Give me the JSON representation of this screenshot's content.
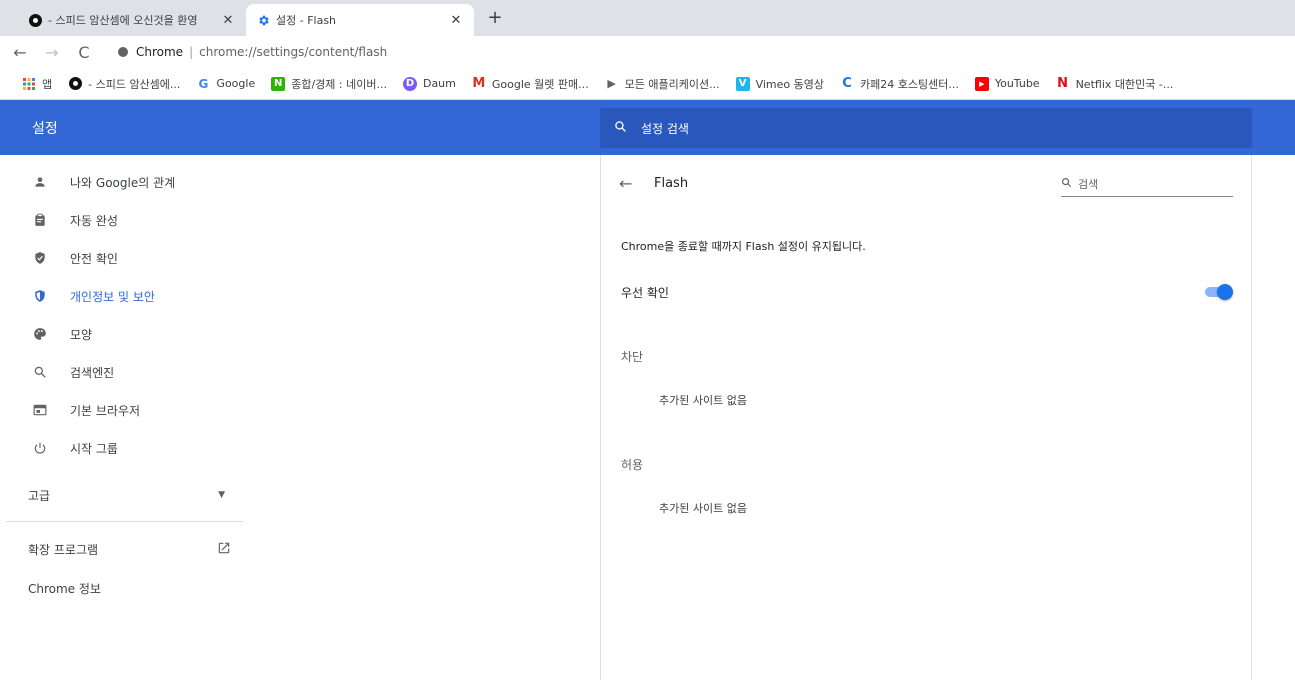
{
  "tabs": [
    {
      "title": "- 스피드 암산셈에 오신것을 환영",
      "close": "✕"
    },
    {
      "title": "설정 - Flash",
      "close": "✕"
    }
  ],
  "newtab": "+",
  "toolbar": {
    "back": "←",
    "forward": "→",
    "reload": "C",
    "site_label": "Chrome",
    "url": "chrome://settings/content/flash"
  },
  "bookmarks": [
    {
      "label": "앱",
      "icon": "apps-grid-icon",
      "color": "#e8453c"
    },
    {
      "label": "- 스피드 암산셈에...",
      "icon": "circle-icon",
      "color": "#111111"
    },
    {
      "label": "Google",
      "icon": "google-icon",
      "color": "#4285f4"
    },
    {
      "label": "종합/경제 : 네이버...",
      "icon": "naver-icon",
      "color": "#2db400"
    },
    {
      "label": "Daum",
      "icon": "daum-icon",
      "color": "#7a5af8"
    },
    {
      "label": "Google 월렛 판매...",
      "icon": "gmail-icon",
      "color": "#d93025"
    },
    {
      "label": "모든 애플리케이션...",
      "icon": "play-icon",
      "color": "#5f6368"
    },
    {
      "label": "Vimeo 동영상",
      "icon": "vimeo-icon",
      "color": "#1ab7ea"
    },
    {
      "label": "카페24 호스팅센터...",
      "icon": "cafe24-icon",
      "color": "#1a73e8"
    },
    {
      "label": "YouTube",
      "icon": "youtube-icon",
      "color": "#ff0000"
    },
    {
      "label": "Netflix 대한민국 -...",
      "icon": "netflix-icon",
      "color": "#e50914"
    }
  ],
  "header": {
    "title": "설정",
    "search_placeholder": "설정 검색"
  },
  "sidebar": {
    "items": [
      {
        "label": "나와 Google의 관계",
        "icon": "person-icon"
      },
      {
        "label": "자동 완성",
        "icon": "clipboard-icon"
      },
      {
        "label": "안전 확인",
        "icon": "shield-check-icon"
      },
      {
        "label": "개인정보 및 보안",
        "icon": "security-shield-icon",
        "active": true
      },
      {
        "label": "모양",
        "icon": "palette-icon"
      },
      {
        "label": "검색엔진",
        "icon": "search-icon"
      },
      {
        "label": "기본 브라우저",
        "icon": "browser-icon"
      },
      {
        "label": "시작 그룹",
        "icon": "power-icon"
      }
    ],
    "advanced": "고급",
    "extensions": "확장 프로그램",
    "about": "Chrome 정보"
  },
  "flash": {
    "title": "Flash",
    "search_placeholder": "검색",
    "description": "Chrome을 종료할 때까지 Flash 설정이 유지됩니다.",
    "ask_first_label": "우선 확인",
    "ask_first_on": true,
    "block_label": "차단",
    "block_empty": "추가된 사이트 없음",
    "allow_label": "허용",
    "allow_empty": "추가된 사이트 없음"
  },
  "colors": {
    "header": "#3367d6",
    "accent": "#1a73e8",
    "active_nav": "#3367d6"
  }
}
